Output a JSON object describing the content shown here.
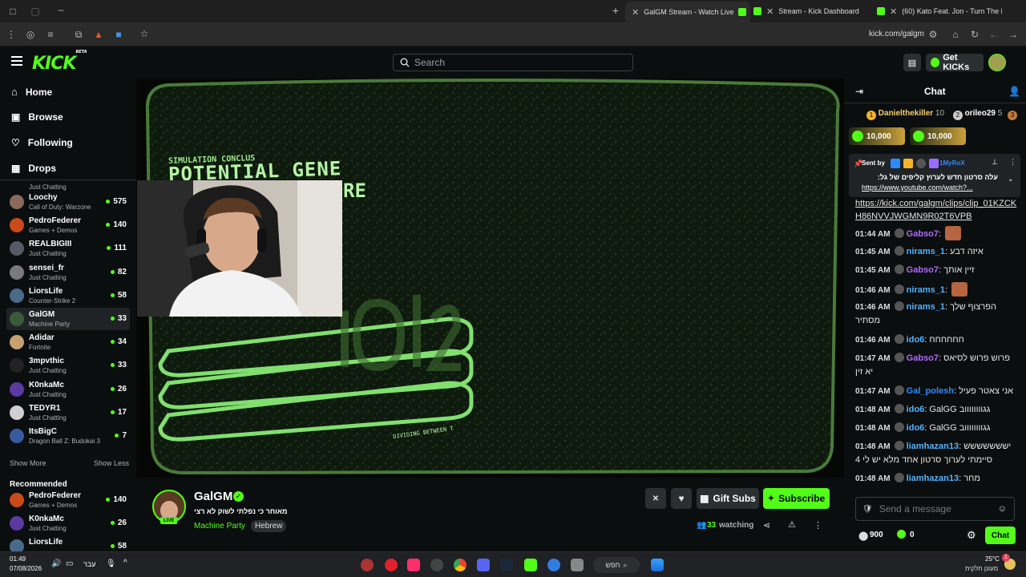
{
  "browser": {
    "tabs": [
      {
        "title": "GalGM Stream - Watch Live",
        "active": true
      },
      {
        "title": "Stream - Kick Dashboard",
        "active": false
      },
      {
        "title": "(60) Kato Feat. Jon - Turn The L",
        "active": false
      }
    ],
    "url": "kick.com/galgm"
  },
  "header": {
    "logo": "KICK",
    "logo_badge": "BETA",
    "search_placeholder": "Search",
    "get_kicks_label": "Get KICKs"
  },
  "sidebar": {
    "nav": [
      {
        "label": "Home",
        "icon": "home-icon"
      },
      {
        "label": "Browse",
        "icon": "browse-icon"
      },
      {
        "label": "Following",
        "icon": "heart-icon"
      },
      {
        "label": "Drops",
        "icon": "drops-icon"
      }
    ],
    "partial_category": "Just Chatting",
    "following": [
      {
        "name": "Loochy",
        "category": "Call of Duty: Warzone",
        "viewers": "575",
        "color": "#8a6a5a"
      },
      {
        "name": "PedroFederer",
        "category": "Games + Demos",
        "viewers": "140",
        "color": "#c94a1a"
      },
      {
        "name": "REALBIGIII",
        "category": "Just Chatting",
        "viewers": "111",
        "color": "#555a66"
      },
      {
        "name": "sensei_fr",
        "category": "Just Chatting",
        "viewers": "82",
        "color": "#7a7a7a"
      },
      {
        "name": "LiorsLife",
        "category": "Counter-Strike 2",
        "viewers": "58",
        "color": "#4a6a8a"
      },
      {
        "name": "GalGM",
        "category": "Machine Party",
        "viewers": "33",
        "color": "#3a5a3a",
        "active": true
      },
      {
        "name": "Adidar",
        "category": "Fortnite",
        "viewers": "34",
        "color": "#c8a070"
      },
      {
        "name": "3mpvthic",
        "category": "Just Chatting",
        "viewers": "33",
        "color": "#222"
      },
      {
        "name": "K0nkaMc",
        "category": "Just Chatting",
        "viewers": "26",
        "color": "#5a3aa0"
      },
      {
        "name": "TEDYR1",
        "category": "Just Chatting",
        "viewers": "17",
        "color": "#d0d0d0"
      },
      {
        "name": "ItsBigC",
        "category": "Dragon Ball Z: Budokai 3",
        "viewers": "7",
        "color": "#3a5aa0"
      }
    ],
    "show_more": "Show More",
    "show_less": "Show Less",
    "recommended_title": "Recommended",
    "recommended": [
      {
        "name": "PedroFederer",
        "category": "Games + Demos",
        "viewers": "140",
        "color": "#c94a1a"
      },
      {
        "name": "K0nkaMc",
        "category": "Just Chatting",
        "viewers": "26",
        "color": "#5a3aa0"
      },
      {
        "name": "LiorsLife",
        "category": "",
        "viewers": "58",
        "color": "#4a6a8a"
      }
    ]
  },
  "video": {
    "overlay_small": "SIMULATION CONCLUS",
    "overlay_big1": "POTENTIAL GENE",
    "overlay_big2": "RE",
    "overlay_foot": "DIVIDING BETWEEN T"
  },
  "stream": {
    "name": "GalGM",
    "live_label": "LIVE",
    "title": "מאוחר כי נפלתי לשוק לא רצי",
    "category": "Machine Party",
    "tag": "Hebrew",
    "viewers": "33",
    "watching_label": "watching",
    "gift_label": "Gift Subs",
    "subscribe_label": "Subscribe"
  },
  "chat": {
    "title": "Chat",
    "leaderboard": [
      {
        "rank": "1",
        "name": "Danielthekiller",
        "count": "10"
      },
      {
        "rank": "2",
        "name": "orileo29",
        "count": "5"
      },
      {
        "rank": "3",
        "name": "",
        "count": ""
      }
    ],
    "kicks": [
      "10,000",
      "10,000"
    ],
    "pinned_sent_by": "Sent by",
    "pinned_user": "1MyRoX",
    "pinned_text": "עלה סרטון חדש לערוץ קליפים של גל:",
    "pinned_link": "https://www.youtube.com/watch?...",
    "link_message": "https://kick.com/galgm/clips/clip_01KZCKH86NVVJWGMN9R02T6VPB",
    "messages": [
      {
        "time": "01:44 AM",
        "user": "Gabso7",
        "color": "#b069ff",
        "text": ""
      },
      {
        "time": "01:45 AM",
        "user": "nirams_1",
        "color": "#53b3ff",
        "text": "איזה דבע"
      },
      {
        "time": "01:45 AM",
        "user": "Gabso7",
        "color": "#b069ff",
        "text": "זיין אותך"
      },
      {
        "time": "01:46 AM",
        "user": "nirams_1",
        "color": "#53b3ff",
        "text": ""
      },
      {
        "time": "01:46 AM",
        "user": "nirams_1",
        "color": "#53b3ff",
        "text": "הפרצוף שלך מסתיר"
      },
      {
        "time": "01:46 AM",
        "user": "ido6",
        "color": "#53b3ff",
        "text": "חחחחחח"
      },
      {
        "time": "01:47 AM",
        "user": "Gabso7",
        "color": "#b069ff",
        "text": "פרוש פרוש לסיאס יא זין"
      },
      {
        "time": "01:47 AM",
        "user": "Gal_polesh",
        "color": "#2e8bff",
        "text": "אני צאטר פעיל"
      },
      {
        "time": "01:48 AM",
        "user": "ido6",
        "color": "#53b3ff",
        "text": "GalGG גגווווווווב"
      },
      {
        "time": "01:48 AM",
        "user": "ido6",
        "color": "#53b3ff",
        "text": "GalGG גגווווווווב"
      },
      {
        "time": "01:48 AM",
        "user": "liamhazan13",
        "color": "#53b3ff",
        "text": "יששששששש סיימתי לערוך סרטון אחד מלא יש לי 4"
      },
      {
        "time": "01:48 AM",
        "user": "liamhazan13",
        "color": "#53b3ff",
        "text": "מחר"
      }
    ],
    "input_placeholder": "Send a message",
    "points": "900",
    "kicks_balance": "0",
    "chat_button": "Chat"
  },
  "taskbar": {
    "time": "01:49",
    "date": "07/08/2026",
    "lang": "עבר",
    "search_label": "חפש",
    "temp": "25°C",
    "weather": "מעונן חלקית",
    "notif_count": "1"
  },
  "colors": {
    "accent": "#53fc18",
    "bg": "#0b0e0f",
    "panel": "#1f2325"
  }
}
